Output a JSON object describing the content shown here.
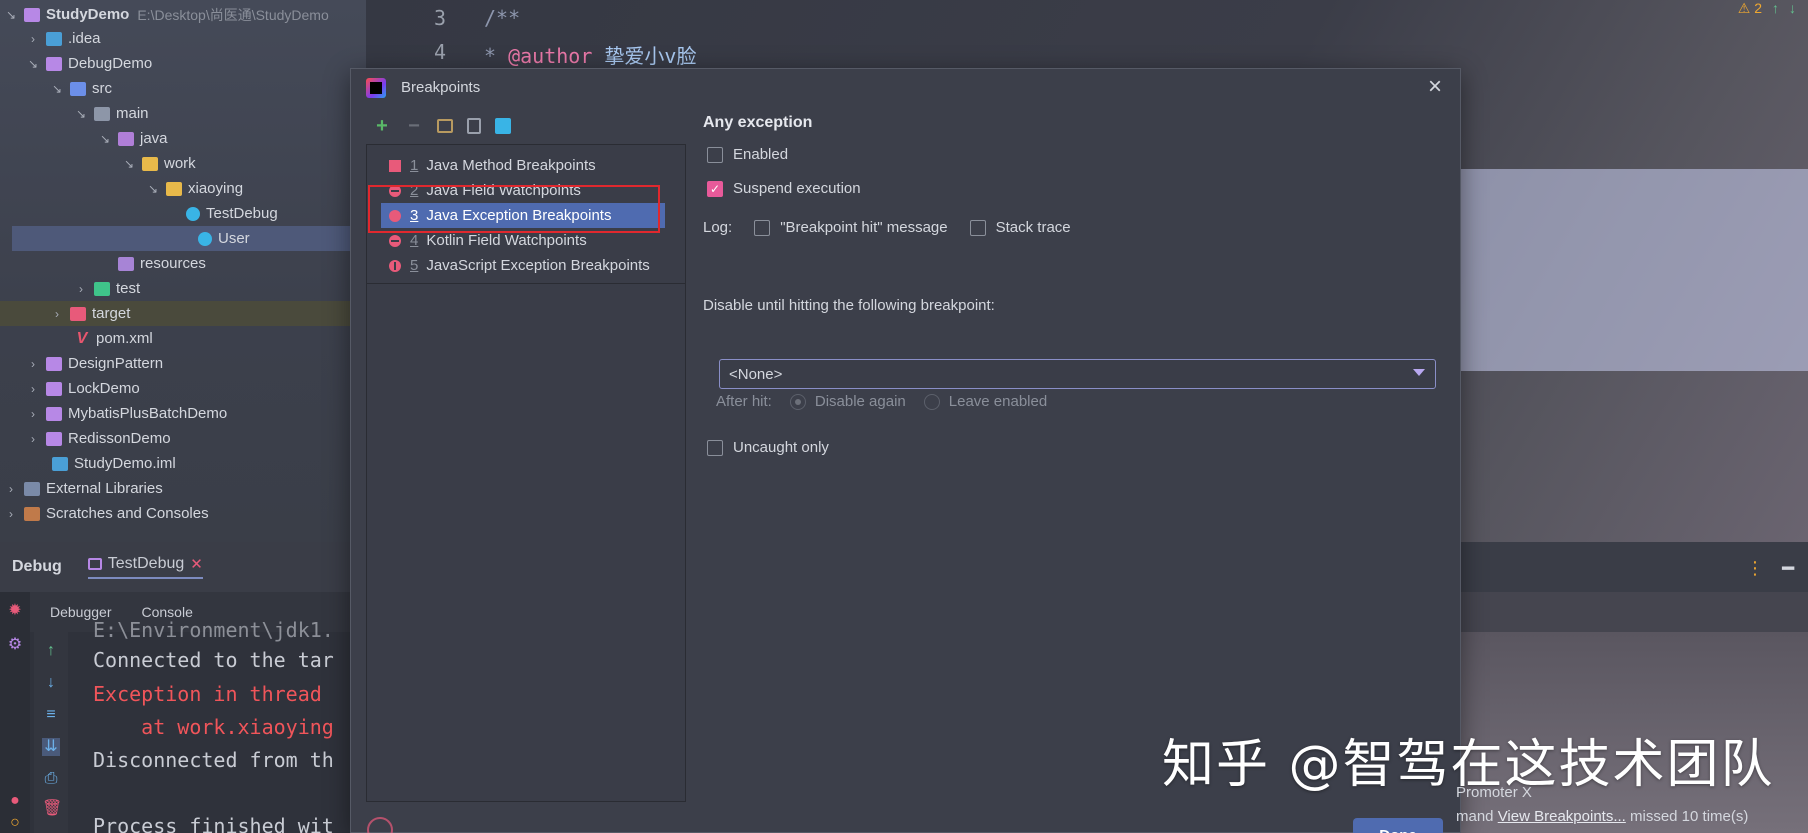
{
  "project_tree": {
    "root": {
      "label": "StudyDemo",
      "path": "E:\\Desktop\\尚医通\\StudyDemo"
    },
    "items": [
      {
        "label": ".idea"
      },
      {
        "label": "DebugDemo"
      },
      {
        "label": "src"
      },
      {
        "label": "main"
      },
      {
        "label": "java"
      },
      {
        "label": "work"
      },
      {
        "label": "xiaoying"
      },
      {
        "label": "TestDebug"
      },
      {
        "label": "User"
      },
      {
        "label": "resources"
      },
      {
        "label": "test"
      },
      {
        "label": "target"
      },
      {
        "label": "pom.xml"
      },
      {
        "label": "DesignPattern"
      },
      {
        "label": "LockDemo"
      },
      {
        "label": "MybatisPlusBatchDemo"
      },
      {
        "label": "RedissonDemo"
      },
      {
        "label": "StudyDemo.iml"
      },
      {
        "label": "External Libraries"
      },
      {
        "label": "Scratches and Consoles"
      }
    ]
  },
  "editor": {
    "lines": [
      {
        "num": "3",
        "text": "/**"
      },
      {
        "num": "4",
        "prefix": " * ",
        "tag": "@author",
        "text": " 挚爱小v脸"
      }
    ],
    "warnings": "2"
  },
  "debug": {
    "title": "Debug",
    "tab": "TestDebug",
    "subtabs": [
      "Debugger",
      "Console"
    ],
    "console_lines": [
      "E:\\Environment\\jdk1.",
      "Connected to the tar",
      "Exception in thread ",
      "    at work.xiaoying",
      "Disconnected from th",
      "",
      "Process finished wit"
    ]
  },
  "dialog": {
    "title": "Breakpoints",
    "list": [
      {
        "num": "1",
        "label": "Java Method Breakpoints"
      },
      {
        "num": "2",
        "label": "Java Field Watchpoints"
      },
      {
        "num": "3",
        "label": "Java Exception Breakpoints"
      },
      {
        "num": "4",
        "label": "Kotlin Field Watchpoints"
      },
      {
        "num": "5",
        "label": "JavaScript Exception Breakpoints"
      }
    ],
    "details": {
      "heading": "Any exception",
      "enabled_label": "Enabled",
      "suspend_label": "Suspend execution",
      "log_label": "Log:",
      "log_message_label": "\"Breakpoint hit\" message",
      "stack_trace_label": "Stack trace",
      "disable_until_label": "Disable until hitting the following breakpoint:",
      "select_value": "<None>",
      "after_hit_label": "After hit:",
      "disable_again_label": "Disable again",
      "leave_enabled_label": "Leave enabled",
      "uncaught_only_label": "Uncaught only"
    },
    "done_label": "Done"
  },
  "notification": {
    "title": "Promoter X",
    "prefix": "mand ",
    "link": "View Breakpoints...",
    "suffix": " missed 10 time(s)"
  },
  "watermark": "知乎 @智驾在这技术团队",
  "colors": {
    "accent_selection": "#4f6bb0",
    "breakpoint_red": "#e85a7a",
    "error_text": "#f0555a",
    "annotation_box": "#e0282e"
  }
}
